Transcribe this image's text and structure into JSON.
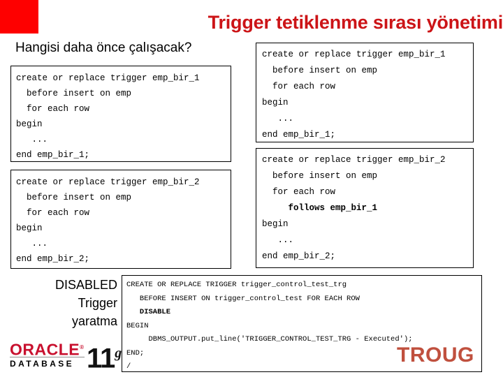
{
  "slide": {
    "title": "Trigger tetiklenme sırası yönetimi",
    "title_color": "#CC1417",
    "question": "Hangisi daha önce çalışacak?",
    "accent_block_color": "#FE0000"
  },
  "left_column": {
    "trigger_1": {
      "lines": [
        {
          "text": "create or replace trigger emp_bir_1",
          "bold": false
        },
        {
          "text": "  before insert on emp",
          "bold": false
        },
        {
          "text": "  for each row",
          "bold": false
        },
        {
          "text": "begin",
          "bold": false
        },
        {
          "text": "   ...",
          "bold": false
        },
        {
          "text": "end emp_bir_1;",
          "bold": false
        }
      ]
    },
    "trigger_2": {
      "lines": [
        {
          "text": "create or replace trigger emp_bir_2",
          "bold": false
        },
        {
          "text": "  before insert on emp",
          "bold": false
        },
        {
          "text": "  for each row",
          "bold": false
        },
        {
          "text": "begin",
          "bold": false
        },
        {
          "text": "   ...",
          "bold": false
        },
        {
          "text": "end emp_bir_2;",
          "bold": false
        }
      ]
    }
  },
  "right_column": {
    "trigger_1": {
      "lines": [
        {
          "text": "create or replace trigger emp_bir_1",
          "bold": false
        },
        {
          "text": "  before insert on emp",
          "bold": false
        },
        {
          "text": "  for each row",
          "bold": false
        },
        {
          "text": "begin",
          "bold": false
        },
        {
          "text": "   ...",
          "bold": false
        },
        {
          "text": "end emp_bir_1;",
          "bold": false
        }
      ]
    },
    "trigger_2": {
      "lines": [
        {
          "text": "create or replace trigger emp_bir_2",
          "bold": false
        },
        {
          "text": "  before insert on emp",
          "bold": false
        },
        {
          "text": "  for each row",
          "bold": false
        },
        {
          "text": "     follows emp_bir_1",
          "bold": true
        },
        {
          "text": "begin",
          "bold": false
        },
        {
          "text": "   ...",
          "bold": false
        },
        {
          "text": "end emp_bir_2;",
          "bold": false
        }
      ]
    }
  },
  "bottom": {
    "caption_lines": [
      "DISABLED",
      "Trigger",
      "yaratma"
    ],
    "code": {
      "lines": [
        {
          "text": "CREATE OR REPLACE TRIGGER trigger_control_test_trg",
          "bold": false
        },
        {
          "text": "   BEFORE INSERT ON trigger_control_test FOR EACH ROW",
          "bold": false
        },
        {
          "text": "   DISABLE",
          "bold": true
        },
        {
          "text": "BEGIN",
          "bold": false
        },
        {
          "text": "     DBMS_OUTPUT.put_line('TRIGGER_CONTROL_TEST_TRG - Executed');",
          "bold": false
        },
        {
          "text": "END;",
          "bold": false
        },
        {
          "text": "/",
          "bold": false
        }
      ]
    }
  },
  "logos": {
    "oracle": {
      "brand": "ORACLE",
      "registered": "®",
      "product": "DATABASE",
      "version_number": "11",
      "version_suffix": "g",
      "brand_color": "#C8102E"
    },
    "troug": {
      "text": "TROUG",
      "color": "#C0503E"
    }
  }
}
